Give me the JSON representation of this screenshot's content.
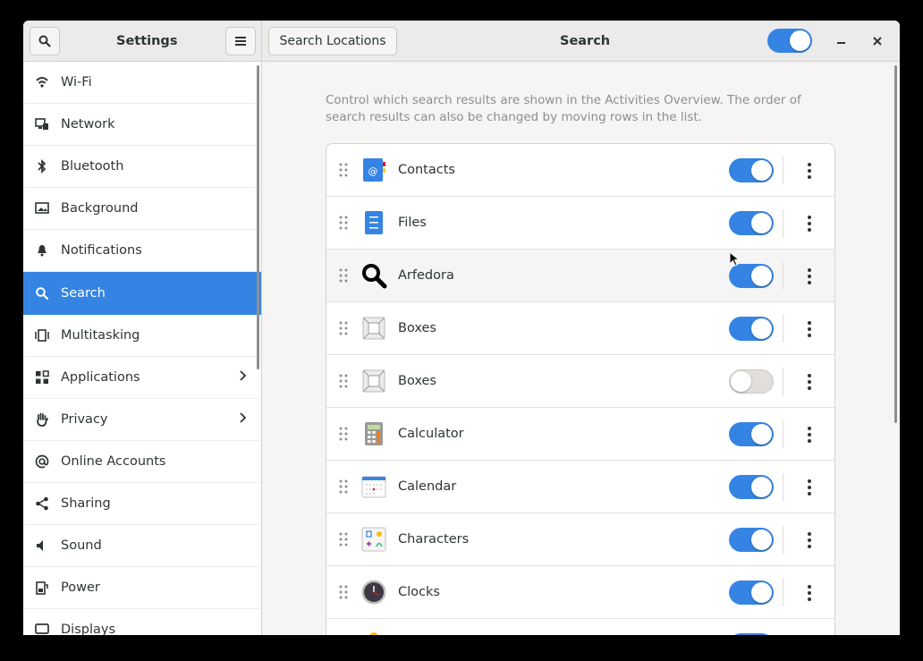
{
  "header": {
    "left_title": "Settings",
    "search_locations": "Search Locations",
    "right_title": "Search",
    "master_toggle": "on"
  },
  "sidebar": {
    "items": [
      {
        "label": "Wi-Fi",
        "icon": "wifi-icon"
      },
      {
        "label": "Network",
        "icon": "network-icon"
      },
      {
        "label": "Bluetooth",
        "icon": "bluetooth-icon"
      },
      {
        "label": "Background",
        "icon": "background-icon"
      },
      {
        "label": "Notifications",
        "icon": "bell-icon"
      },
      {
        "label": "Search",
        "icon": "search-icon",
        "selected": true
      },
      {
        "label": "Multitasking",
        "icon": "multitasking-icon"
      },
      {
        "label": "Applications",
        "icon": "grid-icon",
        "arrow": true
      },
      {
        "label": "Privacy",
        "icon": "hand-icon",
        "arrow": true
      },
      {
        "label": "Online Accounts",
        "icon": "at-icon"
      },
      {
        "label": "Sharing",
        "icon": "share-icon"
      },
      {
        "label": "Sound",
        "icon": "speaker-icon"
      },
      {
        "label": "Power",
        "icon": "power-icon"
      },
      {
        "label": "Displays",
        "icon": "display-icon"
      }
    ]
  },
  "main": {
    "description": "Control which search results are shown in the Activities Overview. The order of search results can also be changed by moving rows in the list.",
    "rows": [
      {
        "label": "Contacts",
        "icon": "contacts-icon",
        "enabled": true
      },
      {
        "label": "Files",
        "icon": "files-icon",
        "enabled": true
      },
      {
        "label": "Arfedora",
        "icon": "magnifier-icon",
        "enabled": true
      },
      {
        "label": "Boxes",
        "icon": "boxes-icon",
        "enabled": true
      },
      {
        "label": "Boxes",
        "icon": "boxes-icon",
        "enabled": false
      },
      {
        "label": "Calculator",
        "icon": "calculator-icon",
        "enabled": true
      },
      {
        "label": "Calendar",
        "icon": "calendar-icon",
        "enabled": true
      },
      {
        "label": "Characters",
        "icon": "characters-icon",
        "enabled": true
      },
      {
        "label": "Clocks",
        "icon": "clocks-icon",
        "enabled": true
      }
    ]
  },
  "colors": {
    "accent": "#3584e4"
  }
}
